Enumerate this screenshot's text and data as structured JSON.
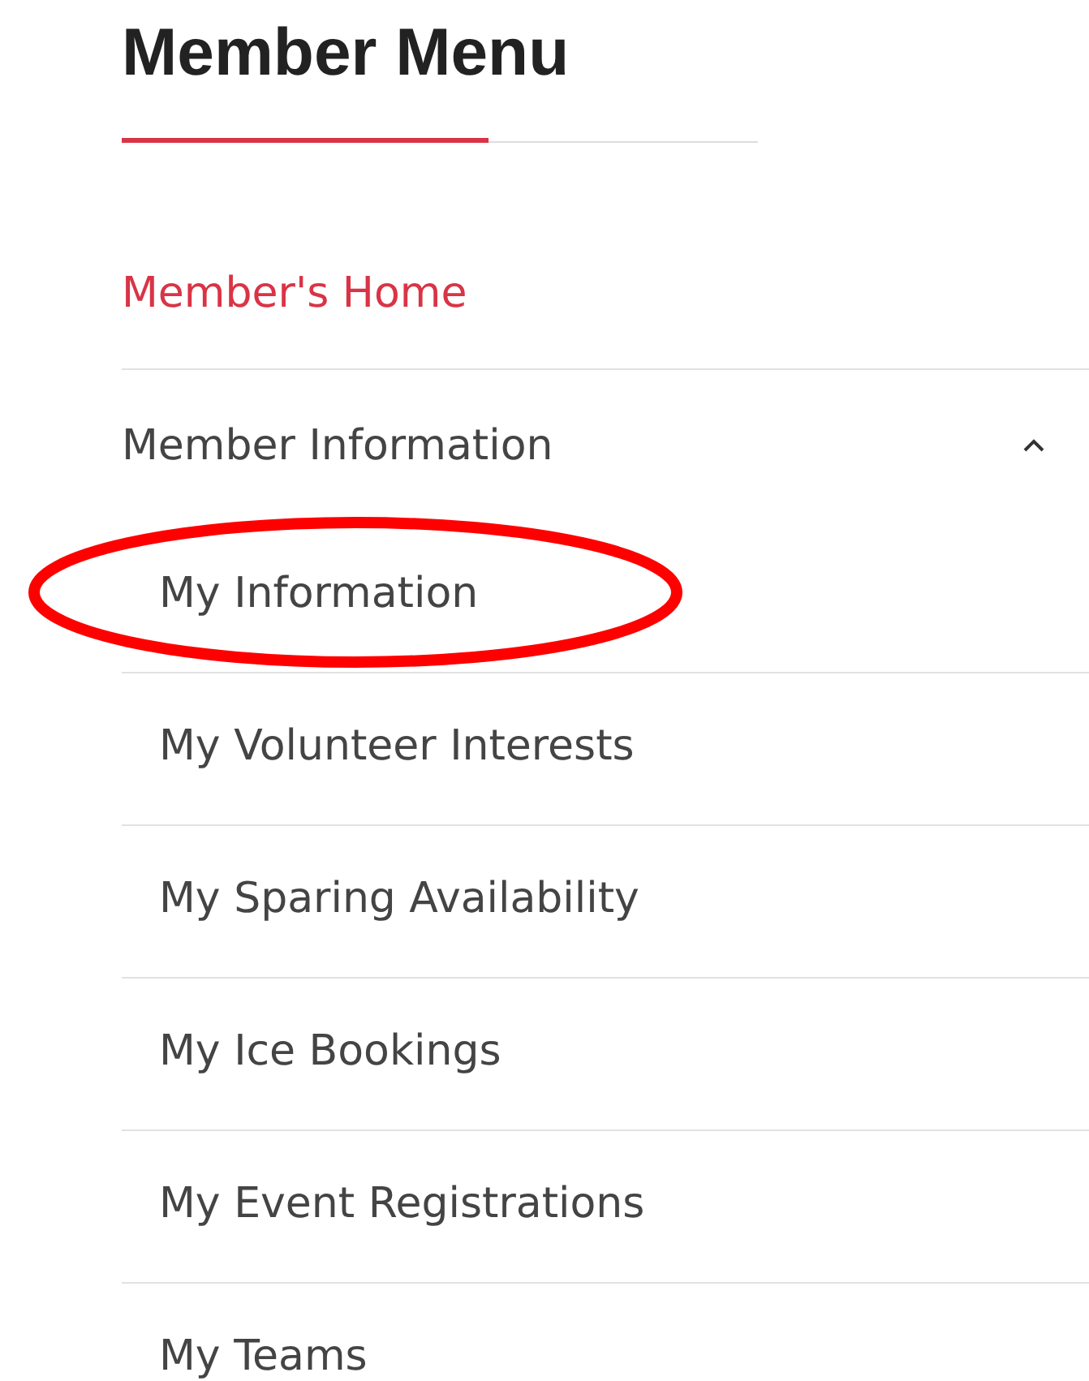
{
  "title": "Member Menu",
  "menu": [
    {
      "kind": "link",
      "label": "Member's Home",
      "selected": true
    },
    {
      "kind": "group",
      "label": "Member Information",
      "selected": false,
      "expanded": true,
      "children": [
        {
          "label": "My Information",
          "selected": false,
          "circled": true
        },
        {
          "label": "My Volunteer Interests",
          "selected": false,
          "circled": false
        },
        {
          "label": "My Sparing Availability",
          "selected": false,
          "circled": false
        },
        {
          "label": "My Ice Bookings",
          "selected": false,
          "circled": false
        },
        {
          "label": "My Event Registrations",
          "selected": false,
          "circled": false
        },
        {
          "label": "My Teams",
          "selected": false,
          "circled": false
        }
      ]
    }
  ]
}
